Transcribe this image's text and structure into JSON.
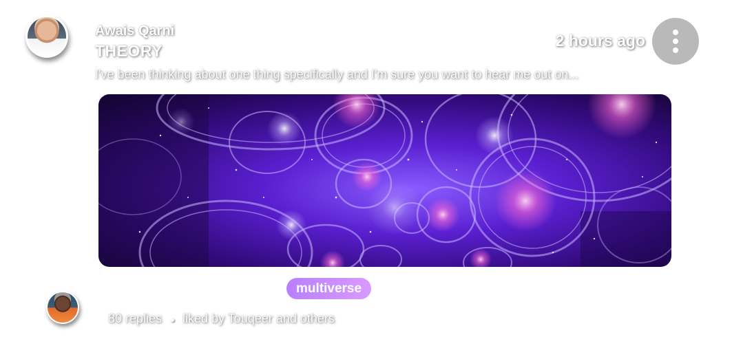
{
  "post": {
    "author": "Awais Qarni",
    "category": "THEORY",
    "timestamp": "2 hours ago",
    "excerpt": "I've been thinking about one thing specifically and I'm sure you want to hear me out on...",
    "tag": "multiverse",
    "replies": "80 replies",
    "liked_by": "liked by Touqeer and others",
    "menu_icon": "more-vertical-icon"
  },
  "colors": {
    "tag_start": "#b880ff",
    "tag_end": "#d99aff",
    "menu_bg": "#b9b9b9",
    "banner_base": "#3a0f8f"
  }
}
